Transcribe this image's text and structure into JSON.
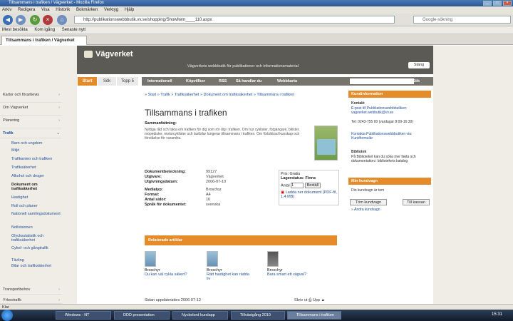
{
  "window": {
    "title": "Tillsammans i trafiken / Vägverket - Mozilla Firefox"
  },
  "menu": [
    "Arkiv",
    "Redigera",
    "Visa",
    "Historik",
    "Bokmärken",
    "Verktyg",
    "Hjälp"
  ],
  "browser": {
    "url": "http://publikationswebbbutik.vv.se/shopping/ShowItem____110.aspx",
    "search_placeholder": "Google-sökning"
  },
  "bookmarks": [
    "Mest besökta",
    "Kom igång",
    "Senaste nytt"
  ],
  "tab": {
    "label": "Tillsammans i trafiken / Vägverket"
  },
  "site": {
    "logo": "Vägverket",
    "tagline": "Vägverkets webbbutik för publikationer och informationsmaterial",
    "close_label": "Stäng",
    "left_tabs": [
      "Start",
      "Sök",
      "Topp 5"
    ],
    "nav": [
      "Internationell",
      "Köpvillkor",
      "RSS",
      "Så handlar du",
      "Webbkarta"
    ],
    "search_button": "Sök",
    "left_menu": [
      "Kartor och förarbevis",
      "Om Vägverket",
      "Planering",
      "Trafik"
    ],
    "sub_menu": [
      "Barn och ungdom",
      "Miljö",
      "Trafikanten och trafiken",
      "Trafiksäkerhet",
      "Alkohol och droger",
      "Dokument om trafiksäkerhet",
      "Hastighet",
      "Roll och planer",
      "Nationell samlingsdokument",
      "Nollvisionen",
      "Olycksstatistik och trafiksäkerhet",
      "Cykel- och gångtrafik",
      "Tävling",
      "Bilar och trafiksäkerhet"
    ],
    "left_menu_bottom": [
      "Transportbehov",
      "Yrkestrafik"
    ]
  },
  "article": {
    "breadcrumb": "» Start » Trafik » Trafiksäkerhet » Dokument om trafiksäkerhet » Tillsammans i trafiken",
    "title": "Tillsammans i trafiken",
    "summary_label": "Sammanfattning:",
    "summary": "Nyttiga råd och fakta om trafiken för dig som rör dig i trafiken. Om hur cyklister, fotgängare, bilister, mopedister, motorcyklister och lastbilar fungerar tillsammans i trafiken. Om förbättrad kunskap och förståelse för varandra.",
    "meta": [
      {
        "key": "Dokumentbeteckning:",
        "value": "99127"
      },
      {
        "key": "Utgivare:",
        "value": "Vägverket"
      },
      {
        "key": "Utgivningsdatum:",
        "value": "2006-07-10"
      },
      {
        "key": "Mediatyp:",
        "value": "Broschyr"
      },
      {
        "key": "Format:",
        "value": "A4"
      },
      {
        "key": "Antal sidor:",
        "value": "16"
      },
      {
        "key": "Språk för dokumentet:",
        "value": "svenska"
      }
    ],
    "price": {
      "label": "Pris: Gratis",
      "stock": "Lagerstatus: Finns",
      "qty_label": "Antal",
      "qty_value": "1",
      "order": "Beställ",
      "download": "Ladda ner dokument (PDF-fil, 1,4 MB)"
    },
    "related_header": "Relaterade artiklar",
    "related": [
      {
        "type": "Broschyr",
        "title": "Du kan väl cykla säkert?"
      },
      {
        "type": "Broschyr",
        "title": "Rätt hastighet kan rädda liv"
      },
      {
        "type": "Broschyr",
        "title": "Bara smart ett vägval?"
      }
    ],
    "last_updated": "Sidan uppdaterades 2006-07-12",
    "print_label": "Skriv ut",
    "up_label": "Upp"
  },
  "sidebar": {
    "kund_header": "Kundinformation",
    "kontakt_title": "Kontakt",
    "kontakt_text": "E-post till Publikationswebbbutiken: vagverket.webbutik@vv.se",
    "tel": "Tel: 0243-755 00 (vardagar 8:00-16:30)",
    "kontakt_extra": "Kontakta Publikationswebbbutiken via: Kundformulär",
    "bibliotek_title": "Bibliotek",
    "bibliotek_text": "På Biblioteket kan du söka mer fakta och dokumentation i bibliotekets katalog",
    "cart_header": "Min kundvagn",
    "cart_status": "Din kundvagn är tom",
    "empty_button": "Töm kundvagn",
    "checkout_button": "Till kassan",
    "cart_link": "» Ändra kundvagn"
  },
  "statusbar": {
    "text": "Klar"
  },
  "taskbar": {
    "items": [
      "Windows - NT",
      "DDD presentation",
      "Nyckelord kurslapp",
      "Tillväxtgång 2010",
      "Tillsammans i trafiken"
    ],
    "clock": "15:31"
  }
}
